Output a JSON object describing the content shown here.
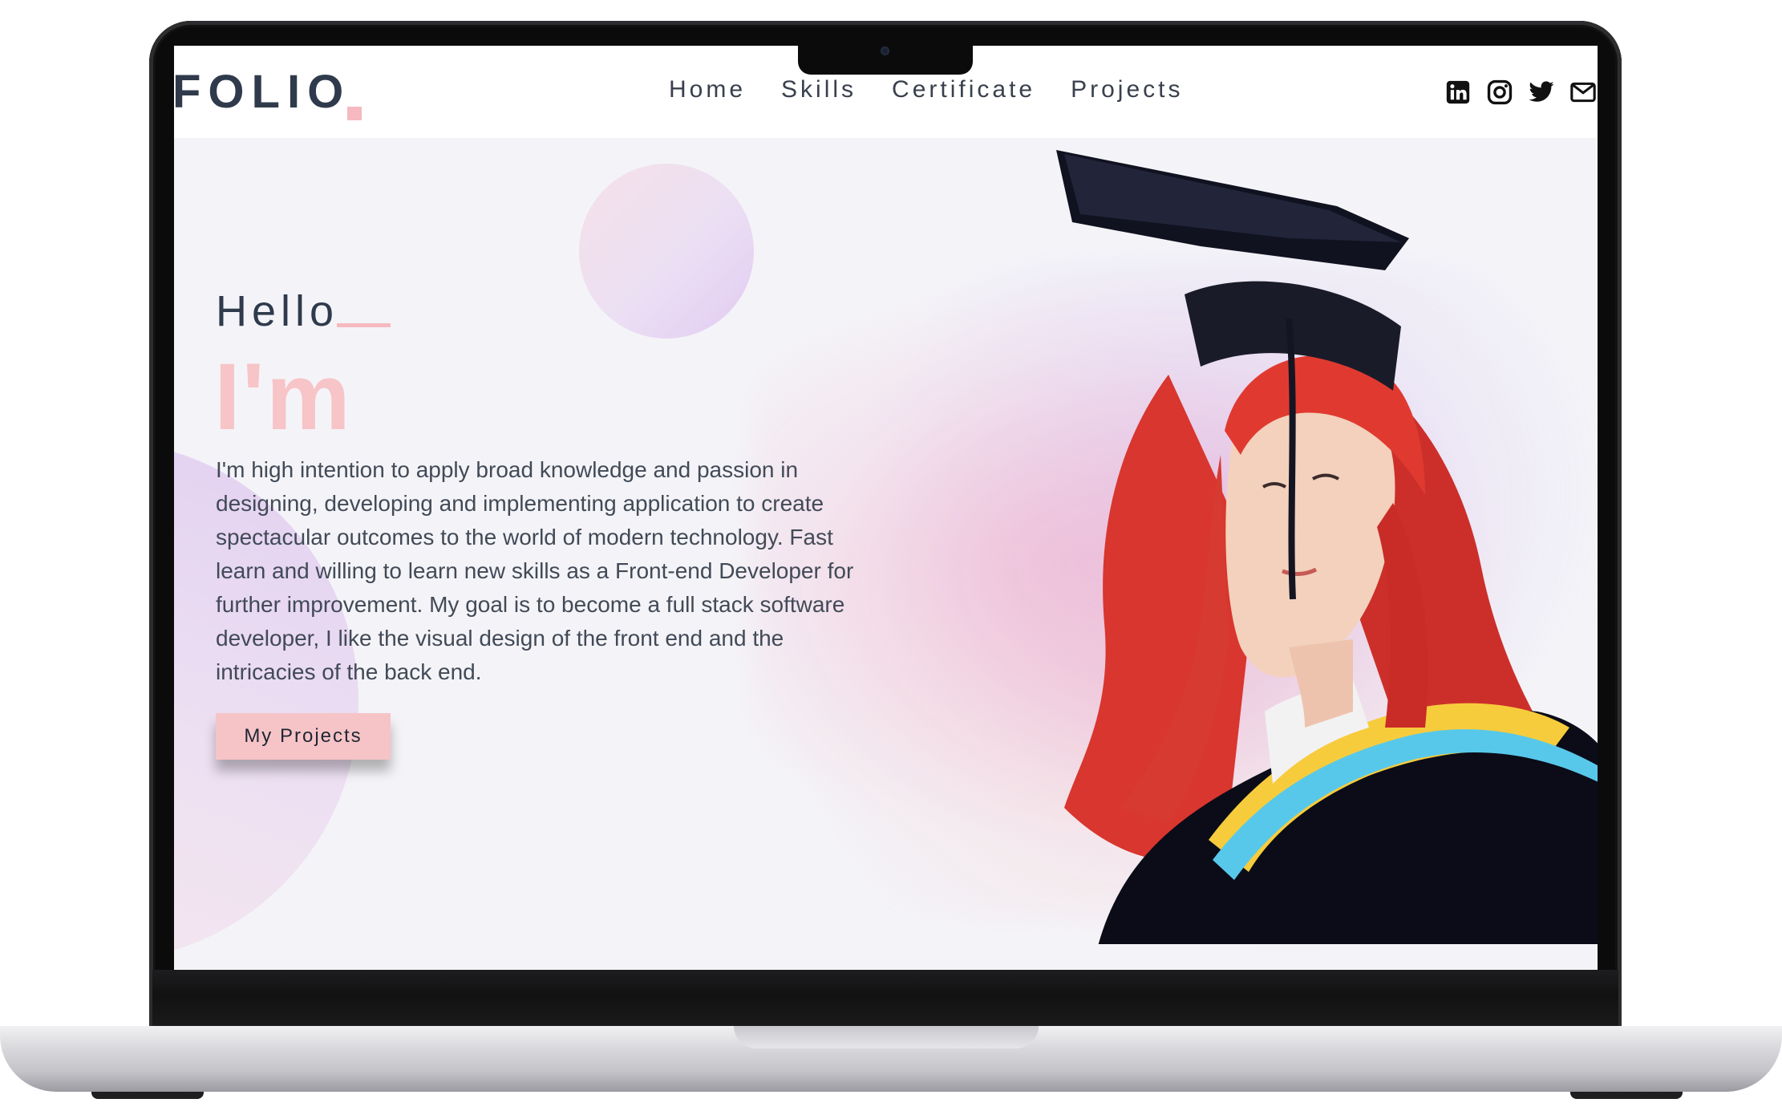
{
  "brand": {
    "logo_text": "FOLIO",
    "accent_color": "#f6b9c0",
    "text_color": "#2f3b4c"
  },
  "nav": {
    "items": [
      {
        "label": "Home"
      },
      {
        "label": "Skills"
      },
      {
        "label": "Certificate"
      },
      {
        "label": "Projects"
      }
    ]
  },
  "socials": [
    {
      "icon": "linkedin-icon"
    },
    {
      "icon": "instagram-icon"
    },
    {
      "icon": "twitter-icon"
    },
    {
      "icon": "mail-icon"
    }
  ],
  "hero": {
    "greeting": "Hello",
    "headline": "I'm",
    "bio": "I'm high intention to apply broad knowledge and passion in designing, developing and implementing application to create spectacular outcomes to the world of modern technology. Fast learn and willing to learn new skills as a Front-end Developer for further improvement. My goal is to become a full stack software developer, I like the visual design of the front end and the intricacies of the back end.",
    "cta_label": "My Projects",
    "cta_color": "#f6c4c7",
    "portrait": "graduation-portrait-illustration"
  }
}
